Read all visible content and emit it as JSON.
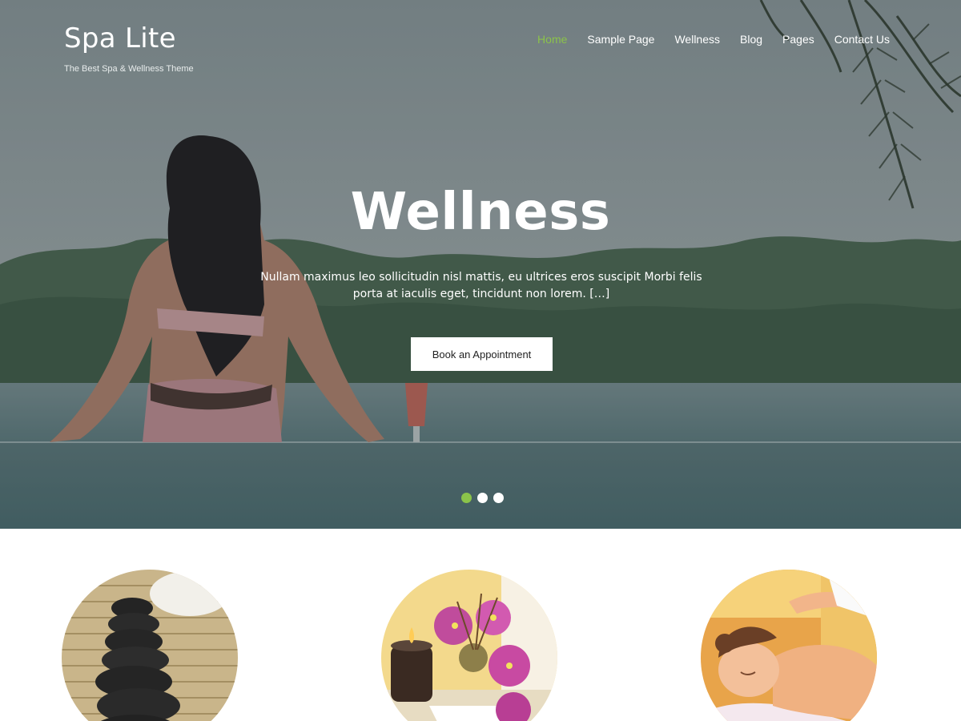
{
  "brand": {
    "title": "Spa Lite",
    "tagline": "The Best Spa & Wellness Theme"
  },
  "nav": {
    "items": [
      {
        "label": "Home",
        "active": true
      },
      {
        "label": "Sample Page",
        "active": false
      },
      {
        "label": "Wellness",
        "active": false
      },
      {
        "label": "Blog",
        "active": false
      },
      {
        "label": "Pages",
        "active": false
      },
      {
        "label": "Contact Us",
        "active": false
      }
    ]
  },
  "hero": {
    "title": "Wellness",
    "text": "Nullam maximus leo sollicitudin nisl mattis, eu ultrices eros suscipit Morbi felis porta at iaculis eget, tincidunt non lorem. […]",
    "button_label": "Book an Appointment",
    "slides": {
      "count": 3,
      "active_index": 0
    }
  },
  "features": [
    {
      "icon": "stacked-stones-image"
    },
    {
      "icon": "candle-and-flowers-image"
    },
    {
      "icon": "massage-image"
    }
  ],
  "colors": {
    "accent": "#8bc34a",
    "white": "#ffffff",
    "button_text": "#222222"
  }
}
